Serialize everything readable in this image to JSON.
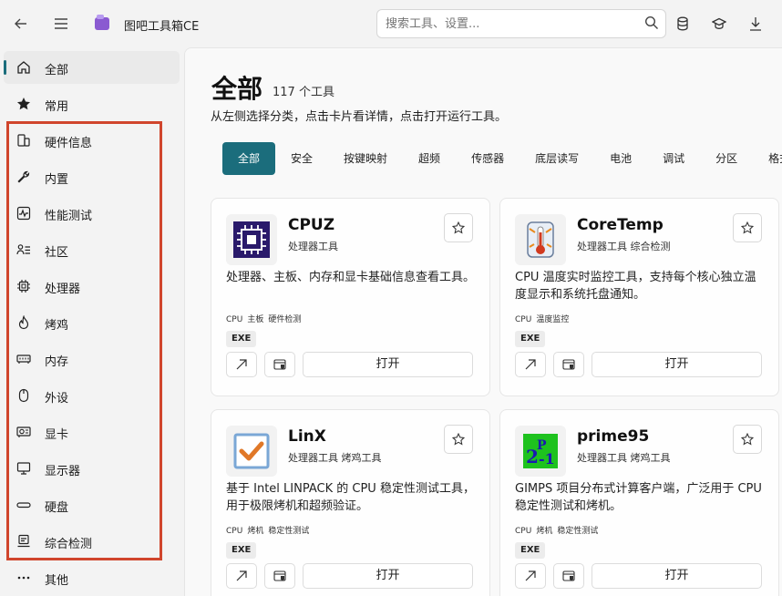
{
  "app": {
    "title": "图吧工具箱CE"
  },
  "search": {
    "placeholder": "搜索工具、设置..."
  },
  "sidebar": {
    "items": [
      {
        "label": "全部",
        "icon": "home-icon"
      },
      {
        "label": "常用",
        "icon": "star-icon"
      },
      {
        "label": "硬件信息",
        "icon": "hardware-info-icon"
      },
      {
        "label": "内置",
        "icon": "wrench-icon"
      },
      {
        "label": "性能测试",
        "icon": "benchmark-icon"
      },
      {
        "label": "社区",
        "icon": "community-icon"
      },
      {
        "label": "处理器",
        "icon": "cpu-icon"
      },
      {
        "label": "烤鸡",
        "icon": "flame-icon"
      },
      {
        "label": "内存",
        "icon": "memory-icon"
      },
      {
        "label": "外设",
        "icon": "mouse-icon"
      },
      {
        "label": "显卡",
        "icon": "gpu-icon"
      },
      {
        "label": "显示器",
        "icon": "monitor-icon"
      },
      {
        "label": "硬盘",
        "icon": "disk-icon"
      },
      {
        "label": "综合检测",
        "icon": "diagnostics-icon"
      },
      {
        "label": "其他",
        "icon": "more-icon"
      }
    ],
    "highlight_color": "#d0452c"
  },
  "main": {
    "title": "全部",
    "count": "117 个工具",
    "subtitle": "从左侧选择分类，点击卡片看详情，点击打开运行工具。",
    "filters": [
      "全部",
      "安全",
      "按键映射",
      "超频",
      "传感器",
      "底层读写",
      "电池",
      "调试",
      "分区",
      "格式化"
    ],
    "accent": "#1b6d7c"
  },
  "cards": [
    {
      "name": "CPUZ",
      "categories": "处理器工具",
      "desc": "处理器、主板、内存和显卡基础信息查看工具。",
      "tags": [
        "CPU",
        "主板",
        "硬件检测"
      ],
      "badge": "EXE",
      "open": "打开",
      "logo": "cpuz-logo"
    },
    {
      "name": "CoreTemp",
      "categories": "处理器工具  综合检测",
      "desc": "CPU 温度实时监控工具，支持每个核心独立温度显示和系统托盘通知。",
      "tags": [
        "CPU",
        "温度监控"
      ],
      "badge": "EXE",
      "open": "打开",
      "logo": "thermometer-logo"
    },
    {
      "name": "LinX",
      "categories": "处理器工具  烤鸡工具",
      "desc": "基于 Intel LINPACK 的 CPU 稳定性测试工具，用于极限烤机和超频验证。",
      "tags": [
        "CPU",
        "烤机",
        "稳定性测试"
      ],
      "badge": "EXE",
      "open": "打开",
      "logo": "checkmark-logo"
    },
    {
      "name": "prime95",
      "categories": "处理器工具  烤鸡工具",
      "desc": "GIMPS 项目分布式计算客户端，广泛用于 CPU 稳定性测试和烤机。",
      "tags": [
        "CPU",
        "烤机",
        "稳定性测试"
      ],
      "badge": "EXE",
      "open": "打开",
      "logo": "prime95-logo",
      "logo_text": "2P-1"
    }
  ]
}
